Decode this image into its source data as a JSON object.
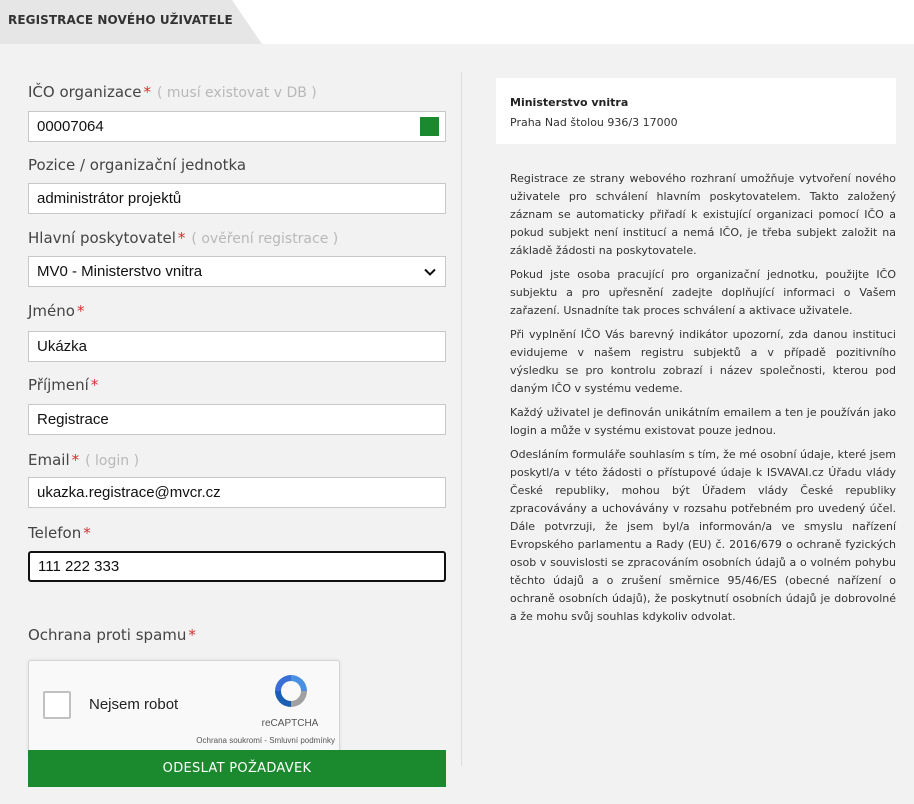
{
  "tab": {
    "title": "REGISTRACE NOVÉHO UŽIVATELE"
  },
  "form": {
    "ico": {
      "label": "IČO organizace",
      "hint": "( musí existovat v DB )",
      "value": "00007064",
      "status_color": "#1b8a2f"
    },
    "position": {
      "label": "Pozice / organizační jednotka",
      "value": "administrátor projektů"
    },
    "provider": {
      "label": "Hlavní poskytovatel",
      "hint": "( ověření registrace )",
      "selected": "MV0 - Ministerstvo vnitra"
    },
    "first_name": {
      "label": "Jméno",
      "value": "Ukázka"
    },
    "last_name": {
      "label": "Příjmení",
      "value": "Registrace"
    },
    "email": {
      "label": "Email",
      "hint": "( login )",
      "value": "ukazka.registrace@mvcr.cz"
    },
    "phone": {
      "label": "Telefon",
      "value": "111 222 333"
    },
    "spam": {
      "label": "Ochrana proti spamu"
    },
    "required_mark": "*",
    "submit_label": "ODESLAT POŽADAVEK"
  },
  "captcha": {
    "checkbox_label": "Nejsem robot",
    "brand": "reCAPTCHA",
    "terms": "Ochrana soukromí - Smluvní podmínky"
  },
  "organization": {
    "name": "Ministerstvo vnitra",
    "address": "Praha Nad štolou 936/3 17000"
  },
  "info": {
    "p1": "Registrace ze strany webového rozhraní umožňuje vytvoření nového uživatele pro schválení hlavním poskytovatelem. Takto založený záznam se automaticky přiřadí k existující organizaci pomocí IČO a pokud subjekt není institucí a nemá IČO, je třeba subjekt založit na základě žádosti na poskytovatele.",
    "p2": "Pokud jste osoba pracující pro organizační jednotku, použijte IČO subjektu a pro upřesnění zadejte doplňující informaci o Vašem zařazení. Usnadníte tak proces schválení a aktivace uživatele.",
    "p3": "Při vyplnění IČO Vás barevný indikátor upozorní, zda danou instituci evidujeme v našem registru subjektů a v případě pozitivního výsledku se pro kontrolu zobrazí i název společnosti, kterou pod daným IČO v systému vedeme.",
    "p4": "Každý uživatel je definován unikátním emailem a ten je používán jako login a může v systému existovat pouze jednou.",
    "p5": "Odesláním formuláře souhlasím s tím, že mé osobní údaje, které jsem poskytl/a v této žádosti o přístupové údaje k ISVAVAI.cz Úřadu vlády České republiky, mohou být Úřadem vlády České republiky zpracovávány a uchovávány v rozsahu potřebném pro uvedený účel. Dále potvrzuji, že jsem byl/a informován/a ve smyslu nařízení Evropského parlamentu a Rady (EU) č. 2016/679 o ochraně fyzických osob v souvislosti se zpracováním osobních údajů a o volném pohybu těchto údajů a o zrušení směrnice 95/46/ES (obecné nařízení o ochraně osobních údajů), že poskytnutí osobních údajů je dobrovolné a že mohu svůj souhlas kdykoliv odvolat."
  }
}
